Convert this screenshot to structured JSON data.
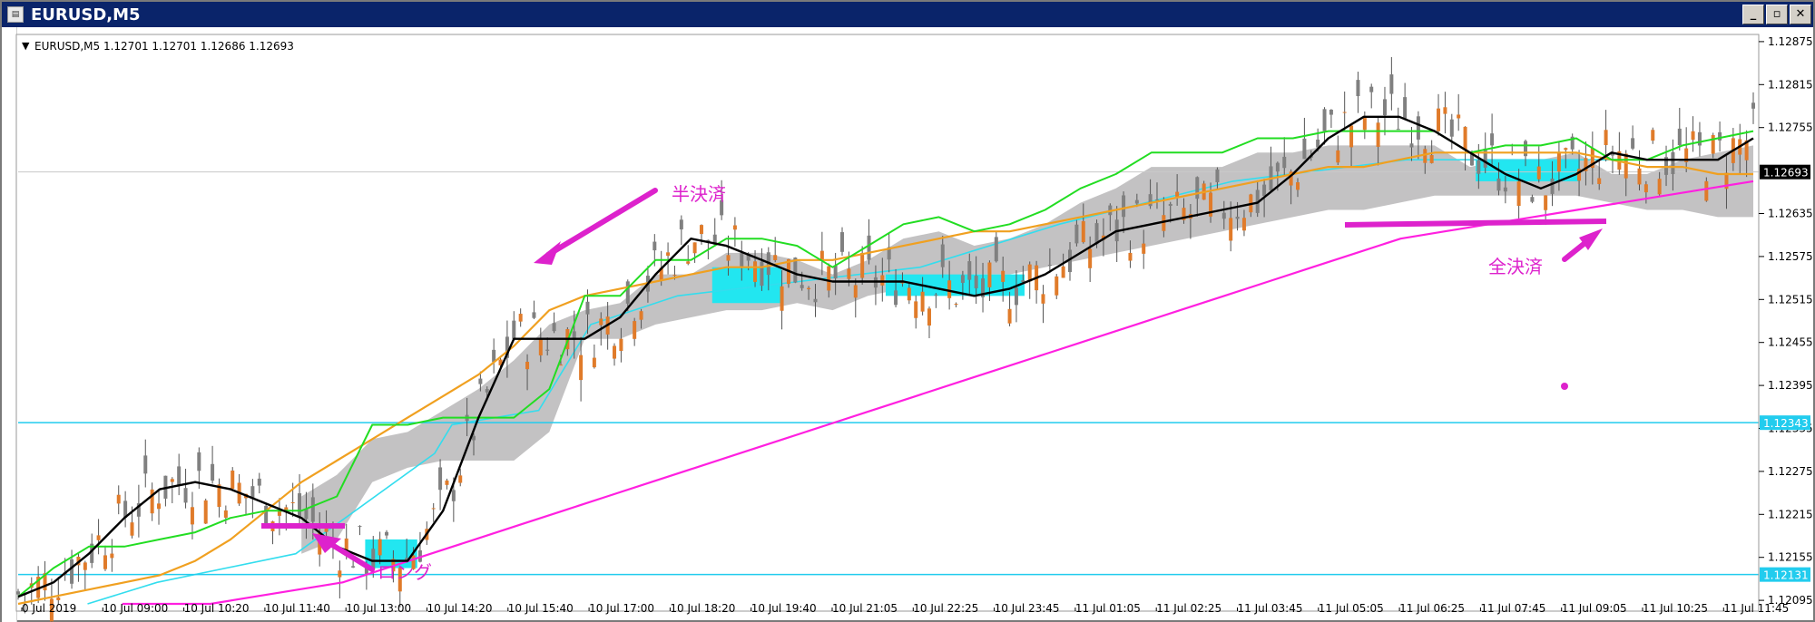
{
  "window": {
    "title": "EURUSD,M5",
    "buttons": {
      "minimize": "_",
      "restore": "▫",
      "close": "✕"
    }
  },
  "chart_header": {
    "arrow": "▼",
    "text": "EURUSD,M5  1.12701 1.12701 1.12686 1.12693"
  },
  "colors": {
    "bull_candle": "#808080",
    "bear_candle": "#e07b2a",
    "black_ma": "#000000",
    "green_line": "#22dd22",
    "orange_ma": "#f0a020",
    "magenta_ma": "#ff20e0",
    "cyan_line": "#33ddee",
    "cloud_gray": "#bdbbbd",
    "cloud_cyan": "#22e6f0",
    "annotation": "#dd22cc",
    "current_price_tag": "#000000",
    "hline_tag": "#22ccee"
  },
  "chart_data": {
    "type": "line",
    "description_free": true,
    "x_tick_labels": [
      "0 Jul 2019",
      "10 Jul 09:00",
      "10 Jul 10:20",
      "10 Jul 11:40",
      "10 Jul 13:00",
      "10 Jul 14:20",
      "10 Jul 15:40",
      "10 Jul 17:00",
      "10 Jul 18:20",
      "10 Jul 19:40",
      "10 Jul 21:05",
      "10 Jul 22:25",
      "10 Jul 23:45",
      "11 Jul 01:05",
      "11 Jul 02:25",
      "11 Jul 03:45",
      "11 Jul 05:05",
      "11 Jul 06:25",
      "11 Jul 07:45",
      "11 Jul 09:05",
      "11 Jul 10:25",
      "11 Jul 11:45"
    ],
    "y_tick_labels": [
      "1.12875",
      "1.12815",
      "1.12755",
      "1.12635",
      "1.12575",
      "1.12515",
      "1.12455",
      "1.12395",
      "1.12335",
      "1.12275",
      "1.12215",
      "1.12155",
      "1.12095"
    ],
    "ylim": [
      1.12085,
      1.12885
    ],
    "current_price": "1.12693",
    "horizontal_lines": [
      {
        "label": "1.12343",
        "value": 1.12343
      },
      {
        "label": "1.12131",
        "value": 1.12131
      }
    ],
    "series": [
      {
        "key": "black_ma",
        "values": [
          1.121,
          1.1212,
          1.1216,
          1.1221,
          1.1225,
          1.1226,
          1.1225,
          1.1223,
          1.1221,
          1.1217,
          1.1215,
          1.1215,
          1.1222,
          1.1235,
          1.1246,
          1.1246,
          1.1246,
          1.1249,
          1.1255,
          1.126,
          1.1259,
          1.1257,
          1.1255,
          1.1254,
          1.1254,
          1.1254,
          1.1253,
          1.1252,
          1.1253,
          1.1255,
          1.1258,
          1.1261,
          1.1262,
          1.1263,
          1.1264,
          1.1265,
          1.1269,
          1.1274,
          1.1277,
          1.1277,
          1.1275,
          1.1272,
          1.1269,
          1.1267,
          1.1269,
          1.1272,
          1.1271,
          1.1271,
          1.1271,
          1.1274
        ]
      },
      {
        "key": "green_line",
        "values": [
          1.121,
          1.1214,
          1.1217,
          1.1217,
          1.1218,
          1.1219,
          1.1221,
          1.1222,
          1.1222,
          1.1224,
          1.1234,
          1.1234,
          1.1235,
          1.1235,
          1.1235,
          1.1239,
          1.1252,
          1.1252,
          1.1257,
          1.1257,
          1.126,
          1.126,
          1.1259,
          1.1256,
          1.1259,
          1.1262,
          1.1263,
          1.1261,
          1.1262,
          1.1264,
          1.1267,
          1.1269,
          1.1272,
          1.1272,
          1.1272,
          1.1274,
          1.1274,
          1.1275,
          1.1275,
          1.1275,
          1.1275,
          1.1272,
          1.1273,
          1.1273,
          1.1274,
          1.1271,
          1.1271,
          1.1273,
          1.1274,
          1.1275
        ]
      },
      {
        "key": "orange_ma",
        "values": [
          1.1209,
          1.121,
          1.1211,
          1.1212,
          1.1213,
          1.1215,
          1.1218,
          1.1222,
          1.1226,
          1.1229,
          1.1232,
          1.1235,
          1.1238,
          1.1241,
          1.1245,
          1.125,
          1.1252,
          1.1253,
          1.1254,
          1.1255,
          1.1256,
          1.1256,
          1.1257,
          1.1257,
          1.1258,
          1.1259,
          1.126,
          1.1261,
          1.1261,
          1.1262,
          1.1263,
          1.1264,
          1.1265,
          1.1266,
          1.1267,
          1.1268,
          1.1269,
          1.127,
          1.127,
          1.1271,
          1.1272,
          1.1272,
          1.1272,
          1.1272,
          1.1272,
          1.1271,
          1.127,
          1.127,
          1.1269,
          1.1269
        ]
      },
      {
        "key": "magenta_ma",
        "values": [
          1.1209,
          1.1209,
          1.1209,
          1.121,
          1.1211,
          1.1212,
          1.1214,
          1.1216,
          1.1218,
          1.122,
          1.1222,
          1.1224,
          1.1226,
          1.1228,
          1.123,
          1.1232,
          1.1234,
          1.1236,
          1.1238,
          1.124,
          1.1242,
          1.1244,
          1.1246,
          1.1248,
          1.125,
          1.1252,
          1.1254,
          1.1256,
          1.1258,
          1.126,
          1.1261,
          1.1262,
          1.1263,
          1.1264,
          1.1265,
          1.1266,
          1.1267,
          1.1268
        ]
      }
    ],
    "annotations": [
      {
        "text": "半決済"
      },
      {
        "text": "ロング"
      },
      {
        "text": "全決済"
      }
    ]
  }
}
